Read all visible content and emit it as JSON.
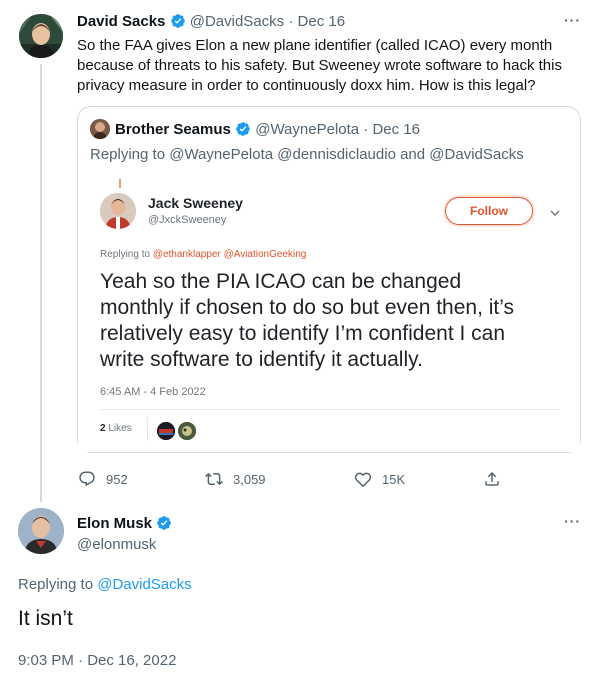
{
  "top_tweet": {
    "author_name": "David Sacks",
    "handle": "@DavidSacks",
    "separator": "·",
    "date": "Dec 16",
    "text_lines": [
      "So the FAA gives Elon a new plane identifier (called ICAO) every month",
      "because of threats to his safety. But Sweeney wrote software to hack this",
      "privacy measure in order to continuously doxx him. How is this legal?"
    ],
    "more": "···"
  },
  "quoted": {
    "author_name": "Brother Seamus",
    "handle": "@WaynePelota",
    "separator": "·",
    "date": "Dec 16",
    "replying_prefix": "Replying to",
    "replying_handles": "@WaynePelota @dennisdiclaudio",
    "replying_and": "and",
    "replying_last": "@DavidSacks"
  },
  "embedded": {
    "author_name": "Jack Sweeney",
    "handle": "@JxckSweeney",
    "follow_label": "Follow",
    "replying_prefix": "Replying to",
    "replying_handles": "@ethanklapper @AviationGeeking",
    "text_lines": [
      "Yeah so the PIA ICAO can be changed",
      "monthly if chosen to do so but even then, it’s",
      "relatively easy to identify I’m confident I can",
      "write software to identify it actually."
    ],
    "timestamp": "6:45 AM - 4 Feb 2022",
    "likes_count": "2",
    "likes_label": "Likes"
  },
  "actions": {
    "replies": "952",
    "retweets": "3,059",
    "likes": "15K"
  },
  "reply": {
    "author_name": "Elon Musk",
    "handle": "@elonmusk",
    "more": "···",
    "replying_prefix": "Replying to",
    "replying_handle": "@DavidSacks",
    "text": "It isn’t",
    "timestamp": "9:03 PM · Dec 16, 2022"
  },
  "colors": {
    "accent": "#1d9bf0",
    "muted": "#536471",
    "follow": "#e0542c"
  }
}
